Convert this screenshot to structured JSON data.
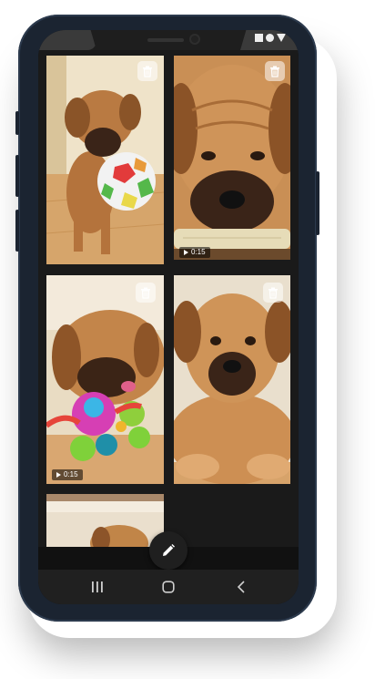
{
  "status_bar": {
    "icons": [
      "square-icon",
      "circle-icon",
      "triangle-icon"
    ]
  },
  "gallery": {
    "tiles": [
      {
        "name": "puppy-with-ball",
        "has_delete": true,
        "duration": ""
      },
      {
        "name": "puppy-on-stick",
        "has_delete": true,
        "duration": "0:15"
      },
      {
        "name": "puppy-with-toys",
        "has_delete": true,
        "duration": "0:15"
      },
      {
        "name": "puppy-lying",
        "has_delete": true,
        "duration": ""
      },
      {
        "name": "puppy-partial",
        "has_delete": false,
        "duration": ""
      }
    ]
  },
  "fab": {
    "icon": "pencil-icon"
  },
  "nav": {
    "items": [
      "recents-icon",
      "home-icon",
      "back-icon"
    ]
  },
  "colors": {
    "phone_frame": "#1b2431",
    "screen_bg": "#111111",
    "nav_bar": "#202020",
    "puppy_fur": "#c99660"
  }
}
